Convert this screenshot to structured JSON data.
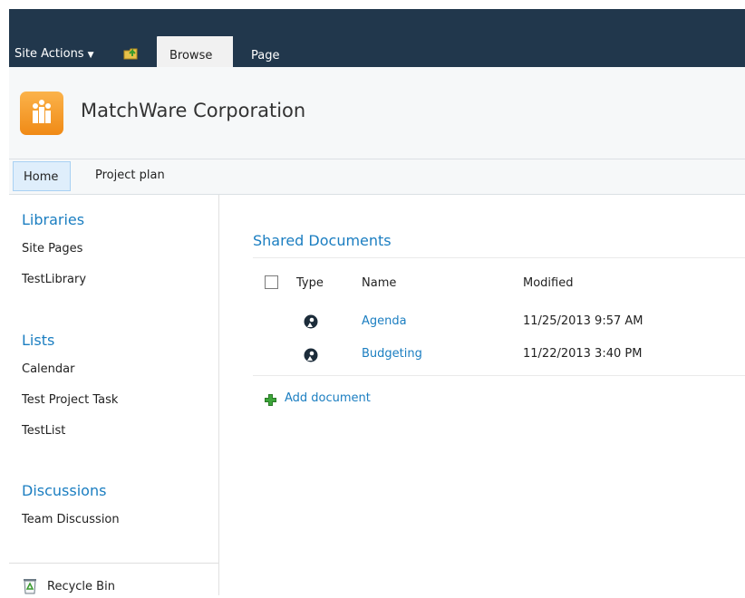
{
  "ribbon": {
    "site_actions": "Site Actions",
    "tabs": [
      {
        "label": "Browse"
      },
      {
        "label": "Page"
      }
    ]
  },
  "site": {
    "title": "MatchWare Corporation"
  },
  "topnav": {
    "items": [
      {
        "label": "Home"
      },
      {
        "label": "Project plan"
      }
    ]
  },
  "quicklaunch": {
    "libraries": {
      "heading": "Libraries",
      "items": [
        "Site Pages",
        "TestLibrary"
      ]
    },
    "lists": {
      "heading": "Lists",
      "items": [
        "Calendar",
        "Test Project Task",
        "TestList"
      ]
    },
    "discussions": {
      "heading": "Discussions",
      "items": [
        "Team Discussion"
      ]
    },
    "recycle_bin": "Recycle Bin"
  },
  "webpart": {
    "title": "Shared Documents",
    "columns": [
      "Type",
      "Name",
      "Modified"
    ],
    "rows": [
      {
        "name": "Agenda",
        "modified": "11/25/2013 9:57 AM"
      },
      {
        "name": "Budgeting",
        "modified": "11/22/2013 3:40 PM"
      }
    ],
    "add_document": "Add document"
  },
  "colors": {
    "ribbon_bg": "#21374c",
    "link_blue": "#1b7ec1",
    "logo_orange": "#f39a24",
    "add_green": "#3da53a"
  },
  "icons": {
    "site_actions": "caret-down-icon",
    "navigate_up": "folder-up-icon",
    "doc_type": "document-icon",
    "add": "plus-icon",
    "recycle": "recycle-bin-icon"
  }
}
